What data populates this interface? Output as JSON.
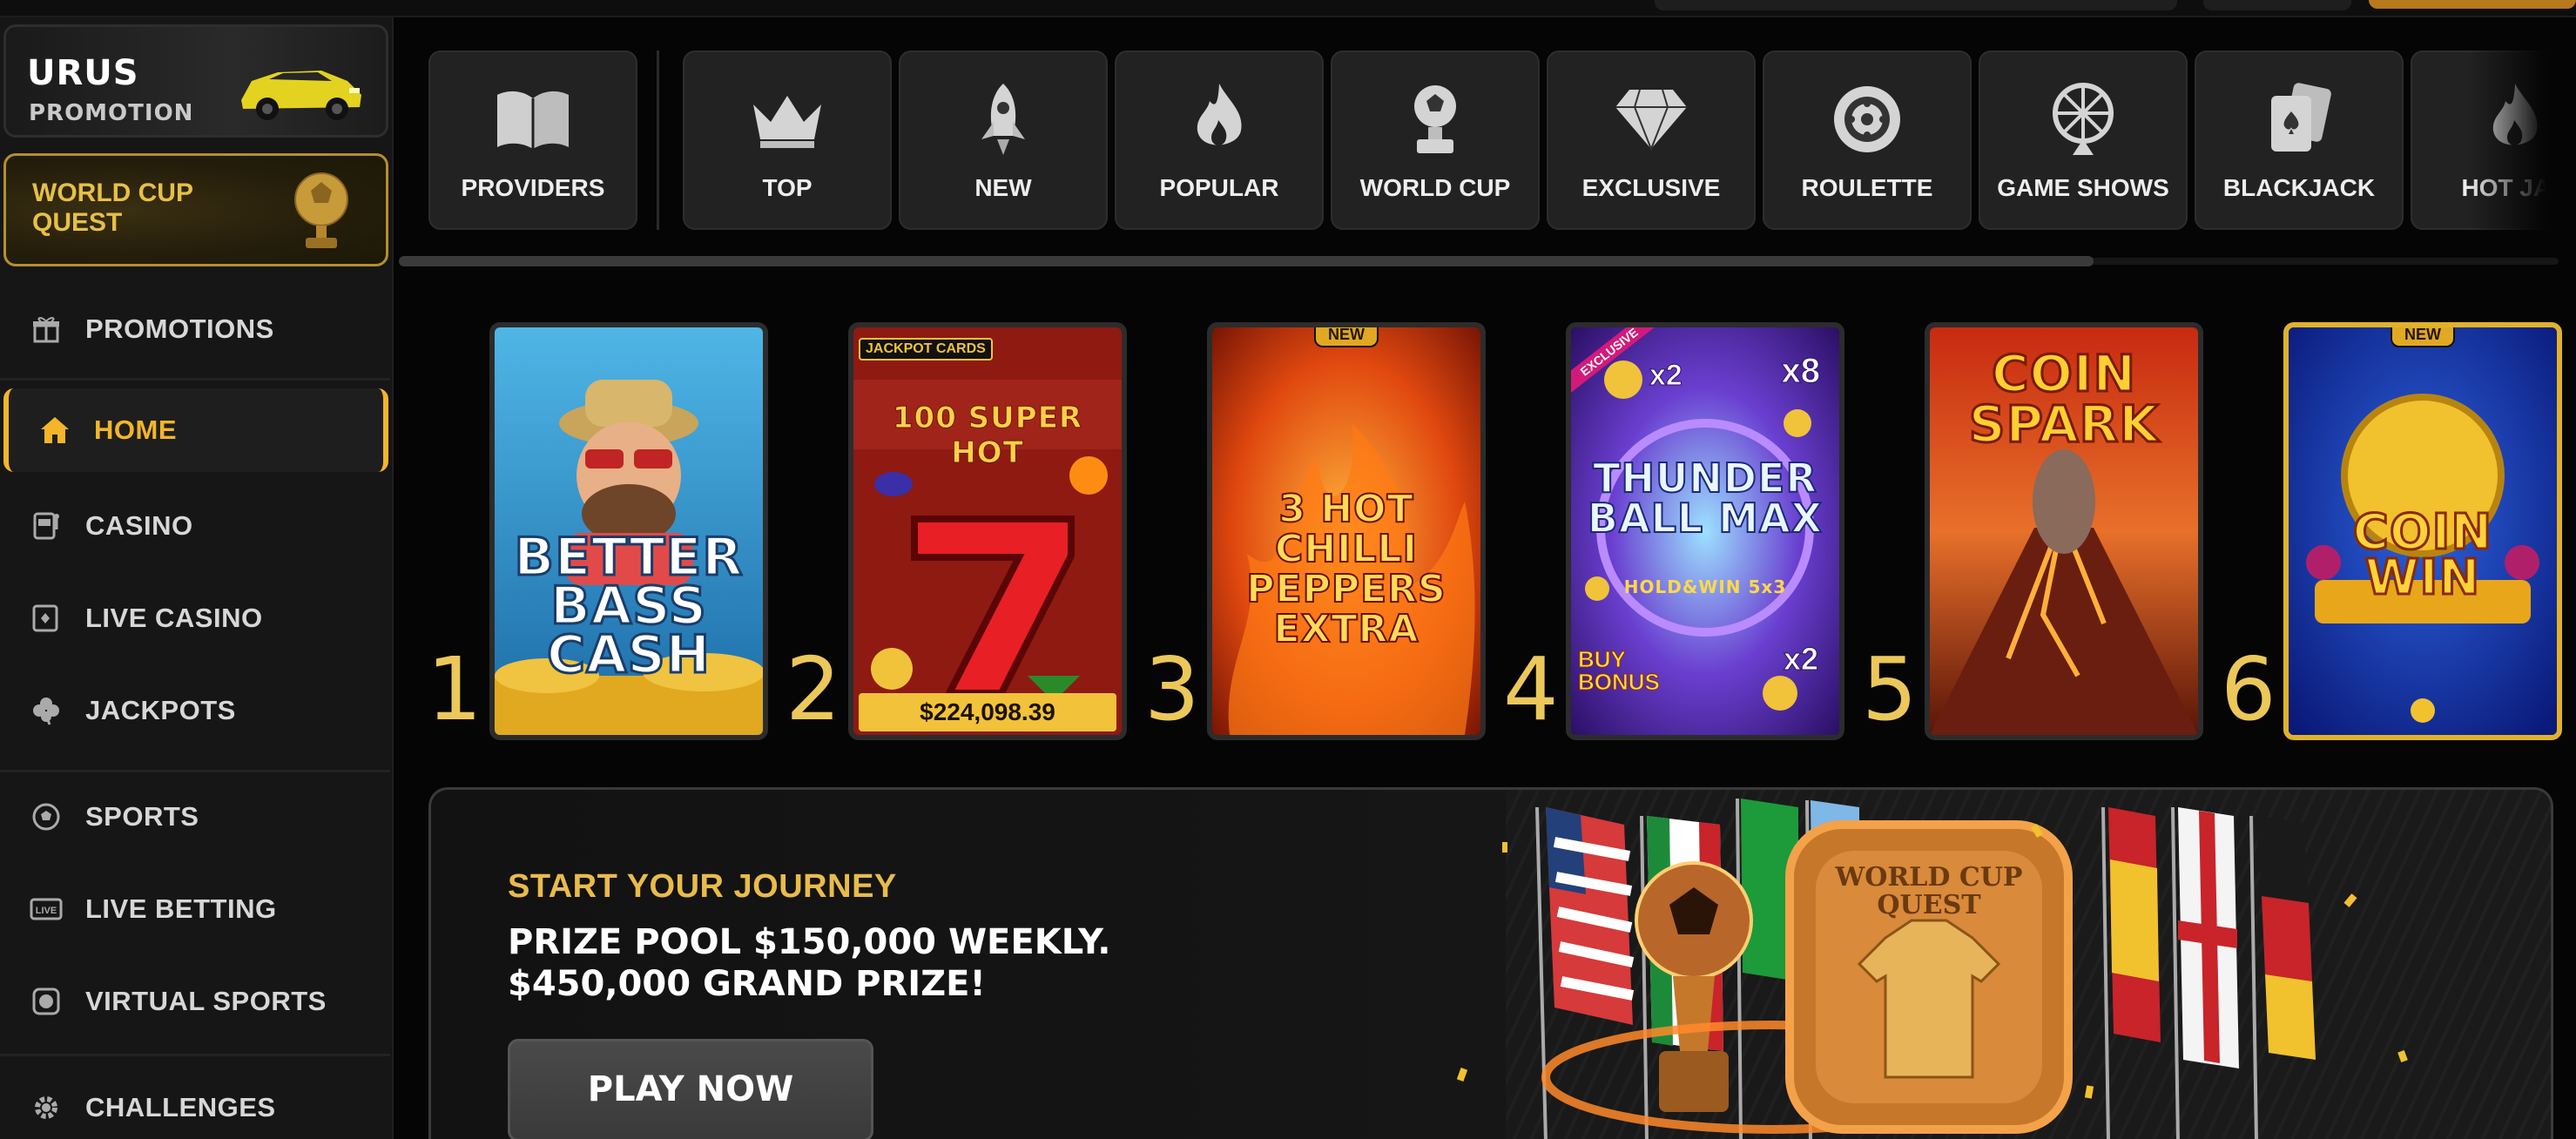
{
  "sidebar": {
    "promo_card": {
      "title": "URUS",
      "subtitle": "PROMOTION"
    },
    "quest_card": {
      "title": "WORLD CUP QUEST"
    },
    "items": [
      {
        "label": "PROMOTIONS",
        "icon": "gift-icon"
      },
      {
        "label": "HOME",
        "icon": "home-icon",
        "active": true
      },
      {
        "label": "CASINO",
        "icon": "slot-machine-icon"
      },
      {
        "label": "LIVE CASINO",
        "icon": "live-cards-icon"
      },
      {
        "label": "JACKPOTS",
        "icon": "clover-icon"
      },
      {
        "label": "SPORTS",
        "icon": "soccer-ball-icon"
      },
      {
        "label": "LIVE BETTING",
        "icon": "live-badge-icon"
      },
      {
        "label": "VIRTUAL SPORTS",
        "icon": "virtual-ball-icon"
      },
      {
        "label": "CHALLENGES",
        "icon": "gear-icon"
      }
    ]
  },
  "categories": [
    {
      "label": "PROVIDERS",
      "icon": "book-icon"
    },
    {
      "label": "TOP",
      "icon": "crown-icon"
    },
    {
      "label": "NEW",
      "icon": "rocket-icon"
    },
    {
      "label": "POPULAR",
      "icon": "flame-icon"
    },
    {
      "label": "WORLD CUP",
      "icon": "trophy-icon"
    },
    {
      "label": "EXCLUSIVE",
      "icon": "diamond-icon"
    },
    {
      "label": "ROULETTE",
      "icon": "roulette-icon"
    },
    {
      "label": "GAME SHOWS",
      "icon": "wheel-icon"
    },
    {
      "label": "BLACKJACK",
      "icon": "cards-icon"
    },
    {
      "label": "HOT JAC",
      "icon": "flame-icon"
    }
  ],
  "top_games": [
    {
      "rank": "1",
      "title": "BETTER BASS CASH",
      "badge": ""
    },
    {
      "rank": "2",
      "title": "100 SUPER HOT",
      "jackpot": "$224,098.39",
      "provider": "JACKPOT CARDS"
    },
    {
      "rank": "3",
      "title": "3 HOT CHILLI PEPPERS EXTRA",
      "badge": "NEW"
    },
    {
      "rank": "4",
      "title": "THUNDER BALL MAX",
      "subtitle": "HOLD&WIN 5x3",
      "tag": "EXCLUSIVE",
      "extra": "BUY BONUS",
      "mult_a": "x2",
      "mult_b": "x8",
      "mult_c": "x2"
    },
    {
      "rank": "5",
      "title": "COIN SPARK"
    },
    {
      "rank": "6",
      "title": "COIN WIN",
      "badge": "NEW"
    }
  ],
  "banner": {
    "kicker": "START YOUR JOURNEY",
    "line1": "PRIZE POOL $150,000 WEEKLY.",
    "line2": "$450,000 GRAND PRIZE!",
    "cta": "PLAY NOW",
    "badge_text": "WORLD CUP QUEST"
  },
  "colors": {
    "accent": "#f3b52a",
    "rank": "#ecc85a",
    "sidebar_bg": "#161616",
    "page_bg": "#050505"
  }
}
